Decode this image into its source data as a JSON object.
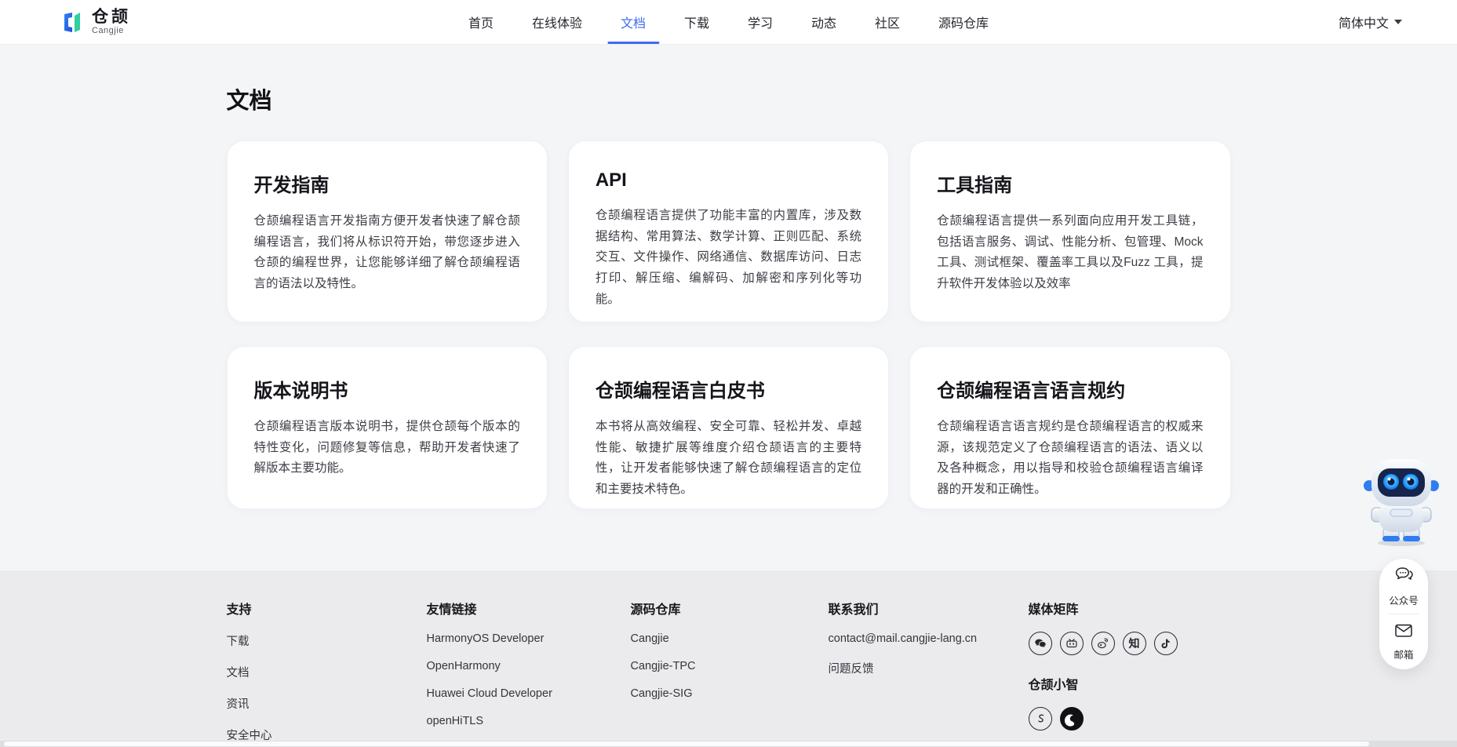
{
  "header": {
    "brand": {
      "name": "仓颉",
      "subtitle": "Cangjie"
    },
    "nav_items": [
      {
        "label": "首页"
      },
      {
        "label": "在线体验"
      },
      {
        "label": "文档"
      },
      {
        "label": "下载"
      },
      {
        "label": "学习"
      },
      {
        "label": "动态"
      },
      {
        "label": "社区"
      },
      {
        "label": "源码仓库"
      }
    ],
    "active_item": "文档",
    "language": "简体中文"
  },
  "page": {
    "title": "文档"
  },
  "cards": [
    {
      "title": "开发指南",
      "body": "仓颉编程语言开发指南方便开发者快速了解仓颉编程语言，我们将从标识符开始，带您逐步进入仓颉的编程世界，让您能够详细了解仓颉编程语言的语法以及特性。"
    },
    {
      "title": "API",
      "body": "仓颉编程语言提供了功能丰富的内置库，涉及数据结构、常用算法、数学计算、正则匹配、系统交互、文件操作、网络通信、数据库访问、日志打印、解压缩、编解码、加解密和序列化等功能。"
    },
    {
      "title": "工具指南",
      "body": "仓颉编程语言提供一系列面向应用开发工具链，包括语言服务、调试、性能分析、包管理、Mock 工具、测试框架、覆盖率工具以及Fuzz 工具，提升软件开发体验以及效率"
    },
    {
      "title": "版本说明书",
      "body": "仓颉编程语言版本说明书，提供仓颉每个版本的特性变化，问题修复等信息，帮助开发者快速了解版本主要功能。"
    },
    {
      "title": "仓颉编程语言白皮书",
      "body": "本书将从高效编程、安全可靠、轻松并发、卓越性能、敏捷扩展等维度介绍仓颉语言的主要特性，让开发者能够快速了解仓颉编程语言的定位和主要技术特色。"
    },
    {
      "title": "仓颉编程语言语言规约",
      "body": "仓颉编程语言语言规约是仓颉编程语言的权威来源，该规范定义了仓颉编程语言的语法、语义以及各种概念，用以指导和校验仓颉编程语言编译器的开发和正确性。"
    }
  ],
  "footer": {
    "columns": [
      {
        "title": "支持",
        "links": [
          "下载",
          "文档",
          "资讯",
          "安全中心"
        ]
      },
      {
        "title": "友情链接",
        "links": [
          "HarmonyOS Developer",
          "OpenHarmony",
          "Huawei Cloud Developer",
          "openHiTLS"
        ]
      },
      {
        "title": "源码仓库",
        "links": [
          "Cangjie",
          "Cangjie-TPC",
          "Cangjie-SIG"
        ]
      },
      {
        "title": "联系我们",
        "links": [
          "contact@mail.cangjie-lang.cn",
          "问题反馈"
        ]
      }
    ],
    "media": {
      "title": "媒体矩阵",
      "icons": [
        "wechat",
        "bilibili",
        "weibo",
        "zhihu",
        "douyin"
      ],
      "zhihu_glyph": "知",
      "douyin_glyph": "♪"
    },
    "assistant": {
      "title": "仓颉小智",
      "icons": [
        "s-curve",
        "swirl"
      ]
    }
  },
  "floating": {
    "buttons": [
      {
        "label": "公众号",
        "icon": "chat-bubbles"
      },
      {
        "label": "邮箱",
        "icon": "envelope"
      }
    ]
  },
  "colors": {
    "accent": "#3d6bf3",
    "logo_blue": "#2b6bf3",
    "logo_green": "#2fd0a0"
  }
}
